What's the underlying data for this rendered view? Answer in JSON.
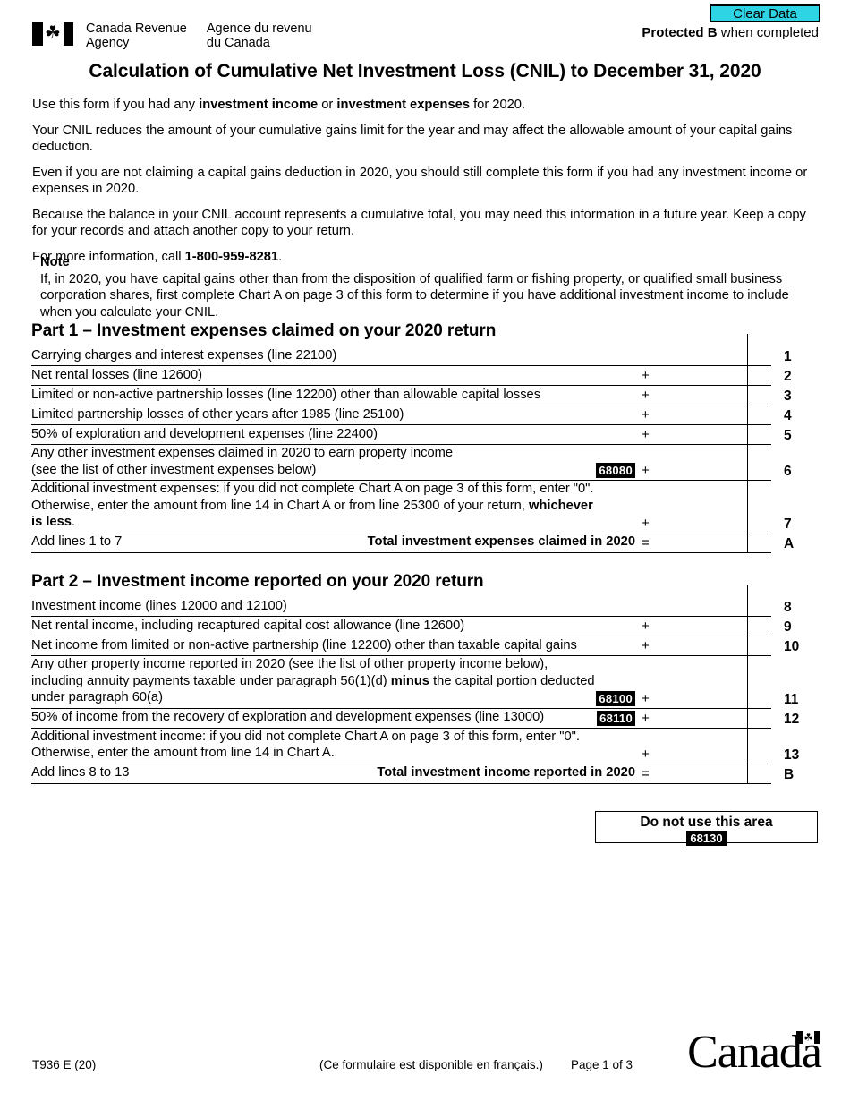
{
  "header": {
    "clear_data_label": "Clear Data",
    "clear_data_color": "#2fd4e4",
    "protected_bold": "Protected B",
    "protected_rest": " when completed",
    "agency_en_line1": "Canada Revenue",
    "agency_en_line2": "Agency",
    "agency_fr_line1": "Agence du revenu",
    "agency_fr_line2": "du Canada",
    "flag_leaf_glyph": "☘"
  },
  "title": "Calculation of Cumulative Net Investment Loss (CNIL) to December 31, 2020",
  "intro": {
    "p1_a": "Use this form if you had any ",
    "p1_b1": "investment income",
    "p1_mid": " or ",
    "p1_b2": "investment expenses",
    "p1_c": " for 2020.",
    "p2": "Your CNIL reduces the amount of your cumulative gains limit for the year and may affect the allowable amount of your capital gains deduction.",
    "p3": "Even if you are not claiming a capital gains deduction in 2020, you should still complete this form if you had any investment income or expenses in 2020.",
    "p4": "Because the balance in your CNIL account represents a cumulative total, you may need this information in a future year. Keep a copy for your records and attach another copy to your return.",
    "p5_a": "For more information, call ",
    "p5_phone": "1-800-959-8281",
    "p5_c": "."
  },
  "note": {
    "title": "Note",
    "body": "If, in 2020, you have capital gains other than from the disposition of qualified farm or fishing property, or qualified small business corporation shares, first complete Chart A on page 3 of this form to determine if you have additional investment income to include when you calculate your CNIL."
  },
  "part1": {
    "heading": "Part 1 – Investment expenses claimed on your 2020 return",
    "rows": [
      {
        "desc": "Carrying charges and interest expenses (line 22100)",
        "op": "",
        "lineno": "1",
        "boxcode": ""
      },
      {
        "desc": "Net rental losses (line 12600)",
        "op": "+",
        "lineno": "2",
        "boxcode": ""
      },
      {
        "desc": "Limited or non-active partnership losses (line 12200) other than allowable capital losses",
        "op": "+",
        "lineno": "3",
        "boxcode": ""
      },
      {
        "desc": "Limited partnership losses of other years after 1985 (line 25100)",
        "op": "+",
        "lineno": "4",
        "boxcode": ""
      },
      {
        "desc": "50% of exploration and development expenses (line 22400)",
        "op": "+",
        "lineno": "5",
        "boxcode": ""
      }
    ],
    "row6": {
      "line1": "Any other investment expenses claimed in 2020 to earn property income",
      "line2": "(see the list of other investment expenses below)",
      "boxcode": "68080",
      "op": "+",
      "lineno": "6"
    },
    "row7": {
      "line1": "Additional investment expenses: if you did not complete Chart A on page 3 of this form, enter \"0\".",
      "line2_a": "Otherwise, enter the amount from line 14 in Chart A or from line 25300 of your return, ",
      "line2_b": "whichever",
      "line3_b": "is less",
      "line3_c": ".",
      "op": "+",
      "lineno": "7"
    },
    "rowA": {
      "desc": "Add lines 1 to 7",
      "total_label": "Total investment expenses claimed in 2020",
      "op": "=",
      "lineno": "A"
    }
  },
  "part2": {
    "heading": "Part 2 – Investment income reported on your 2020 return",
    "rows": [
      {
        "desc": "Investment income (lines 12000 and 12100)",
        "op": "",
        "lineno": "8",
        "boxcode": ""
      },
      {
        "desc": "Net rental income, including recaptured capital cost allowance (line 12600)",
        "op": "+",
        "lineno": "9",
        "boxcode": ""
      },
      {
        "desc": "Net income from limited or non-active partnership (line 12200) other than taxable capital gains",
        "op": "+",
        "lineno": "10",
        "boxcode": ""
      }
    ],
    "row11": {
      "line1": "Any other property income reported in 2020 (see the list of other property income below),",
      "line2_a": "including annuity payments taxable under paragraph 56(1)(d) ",
      "line2_b": "minus",
      "line2_c": " the capital portion deducted",
      "line3": "under paragraph 60(a)",
      "boxcode": "68100",
      "op": "+",
      "lineno": "11"
    },
    "row12": {
      "desc": "50% of income from the recovery of exploration and development expenses (line 13000)",
      "boxcode": "68110",
      "op": "+",
      "lineno": "12"
    },
    "row13": {
      "line1": "Additional investment income: if you did not complete Chart A on page 3 of this form, enter \"0\".",
      "line2": "Otherwise, enter the amount from line 14 in Chart A.",
      "op": "+",
      "lineno": "13"
    },
    "rowB": {
      "desc": "Add lines 8 to 13",
      "total_label": "Total investment income reported in 2020",
      "op": "=",
      "lineno": "B"
    }
  },
  "do_not_use": {
    "title": "Do not use this area",
    "boxcode": "68130"
  },
  "footer": {
    "form_id": "T936 E (20)",
    "french_note": "(Ce formulaire est disponible en français.)",
    "page": "Page 1 of 3",
    "wordmark": "Canada",
    "wordmark_leaf": "☘"
  }
}
